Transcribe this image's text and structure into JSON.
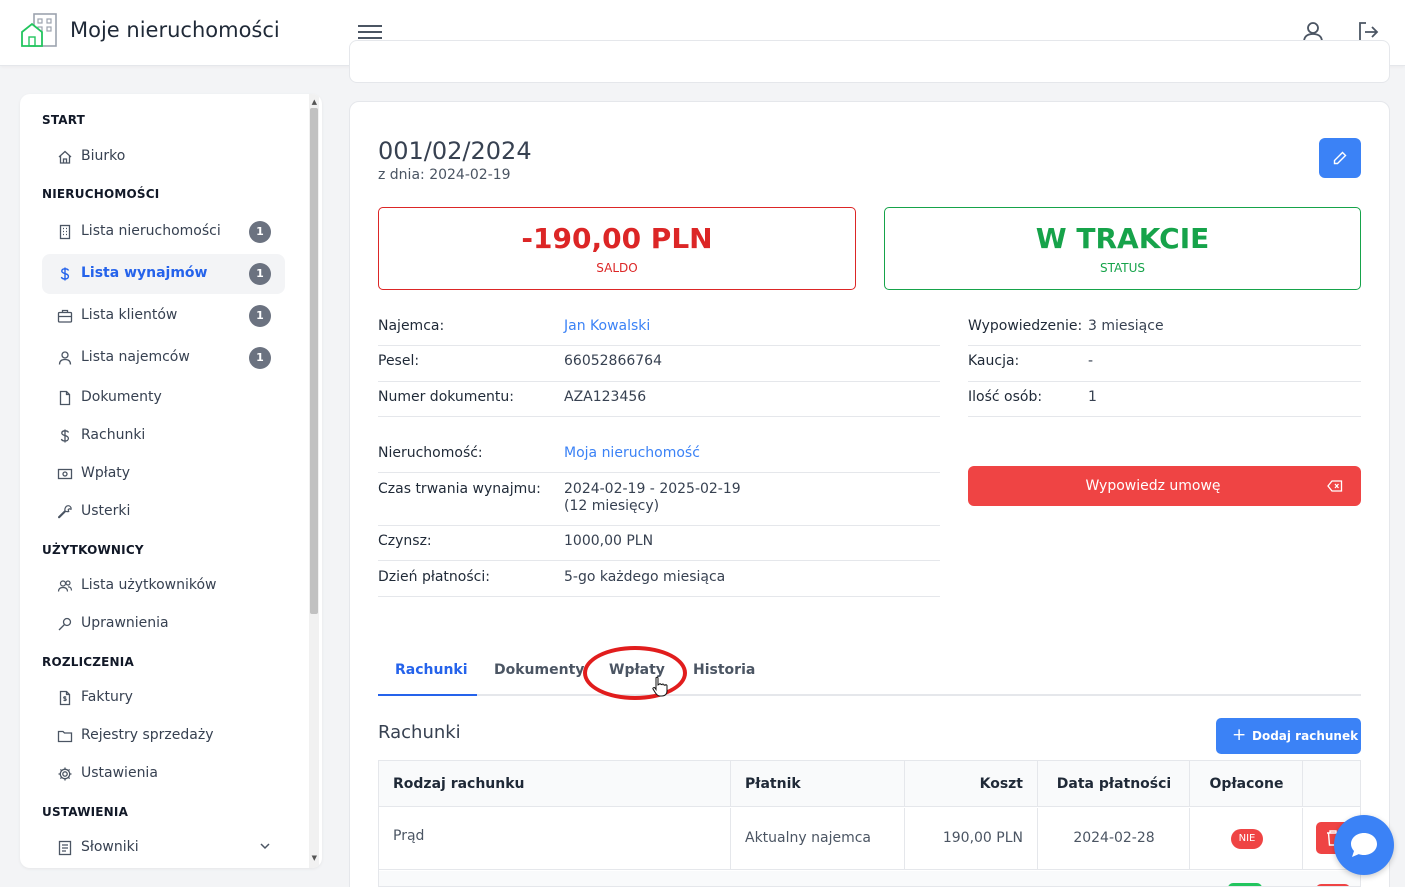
{
  "header": {
    "app_title": "Moje nieruchomości",
    "logo_icon": "building-house-icon",
    "menu_icon": "hamburger-menu-icon",
    "user_icon": "user-icon",
    "logout_icon": "logout-icon"
  },
  "sidebar": {
    "sections": [
      {
        "title": "START"
      },
      {
        "title": "NIERUCHOMOŚCI"
      },
      {
        "title": "UŻYTKOWNICY"
      },
      {
        "title": "ROZLICZENIA"
      },
      {
        "title": "USTAWIENIA"
      }
    ],
    "items": [
      {
        "label": "Biurko",
        "icon": "home-icon"
      },
      {
        "label": "Lista nieruchomości",
        "icon": "building-icon",
        "badge": "1"
      },
      {
        "label": "Lista wynajmów",
        "icon": "dollar-icon",
        "badge": "1",
        "active": true
      },
      {
        "label": "Lista klientów",
        "icon": "briefcase-icon",
        "badge": "1"
      },
      {
        "label": "Lista najemców",
        "icon": "user-icon",
        "badge": "1"
      },
      {
        "label": "Dokumenty",
        "icon": "document-icon"
      },
      {
        "label": "Rachunki",
        "icon": "dollar-icon"
      },
      {
        "label": "Wpłaty",
        "icon": "cash-icon"
      },
      {
        "label": "Usterki",
        "icon": "wrench-icon"
      },
      {
        "label": "Lista użytkowników",
        "icon": "users-icon"
      },
      {
        "label": "Uprawnienia",
        "icon": "key-icon"
      },
      {
        "label": "Faktury",
        "icon": "invoice-icon"
      },
      {
        "label": "Rejestry sprzedaży",
        "icon": "folder-icon"
      },
      {
        "label": "Ustawienia",
        "icon": "gear-icon"
      },
      {
        "label": "Słowniki",
        "icon": "book-icon",
        "expandable": true
      }
    ]
  },
  "rental": {
    "number": "001/02/2024",
    "date_line": "z dnia: 2024-02-19",
    "saldo_value": "-190,00 PLN",
    "saldo_label": "SALDO",
    "status_value": "W TRAKCIE",
    "status_label": "STATUS",
    "colors": {
      "saldo": "#dc2626",
      "status": "#16a34a",
      "accent": "#3b82f6"
    },
    "left_details": [
      {
        "key": "Najemca:",
        "value": "Jan Kowalski",
        "link": true
      },
      {
        "key": "Pesel:",
        "value": "66052866764"
      },
      {
        "key": "Numer dokumentu:",
        "value": "AZA123456"
      },
      {
        "key": "Nieruchomość:",
        "value": "Moja nieruchomość",
        "link": true
      },
      {
        "key": "Czas trwania wynajmu:",
        "value": "2024-02-19 - 2025-02-19",
        "value2": "(12 miesięcy)"
      },
      {
        "key": "Czynsz:",
        "value": "1000,00 PLN"
      },
      {
        "key": "Dzień płatności:",
        "value": "5-go każdego miesiąca"
      }
    ],
    "right_details": [
      {
        "key": "Wypowiedzenie:",
        "value": "3 miesiące"
      },
      {
        "key": "Kaucja:",
        "value": "-"
      },
      {
        "key": "Ilość osób:",
        "value": "1"
      }
    ],
    "terminate_label": "Wypowiedz umowę"
  },
  "tabs": [
    {
      "label": "Rachunki",
      "active": true
    },
    {
      "label": "Dokumenty"
    },
    {
      "label": "Wpłaty"
    },
    {
      "label": "Historia"
    }
  ],
  "bills": {
    "title": "Rachunki",
    "add_label": "Dodaj rachunek",
    "columns": [
      "Rodzaj rachunku",
      "Płatnik",
      "Koszt",
      "Data płatności",
      "Opłacone"
    ],
    "rows": [
      {
        "type": "Prąd",
        "payer": "Aktualny najemca",
        "cost": "190,00 PLN",
        "date": "2024-02-28",
        "paid": "NIE"
      }
    ]
  }
}
